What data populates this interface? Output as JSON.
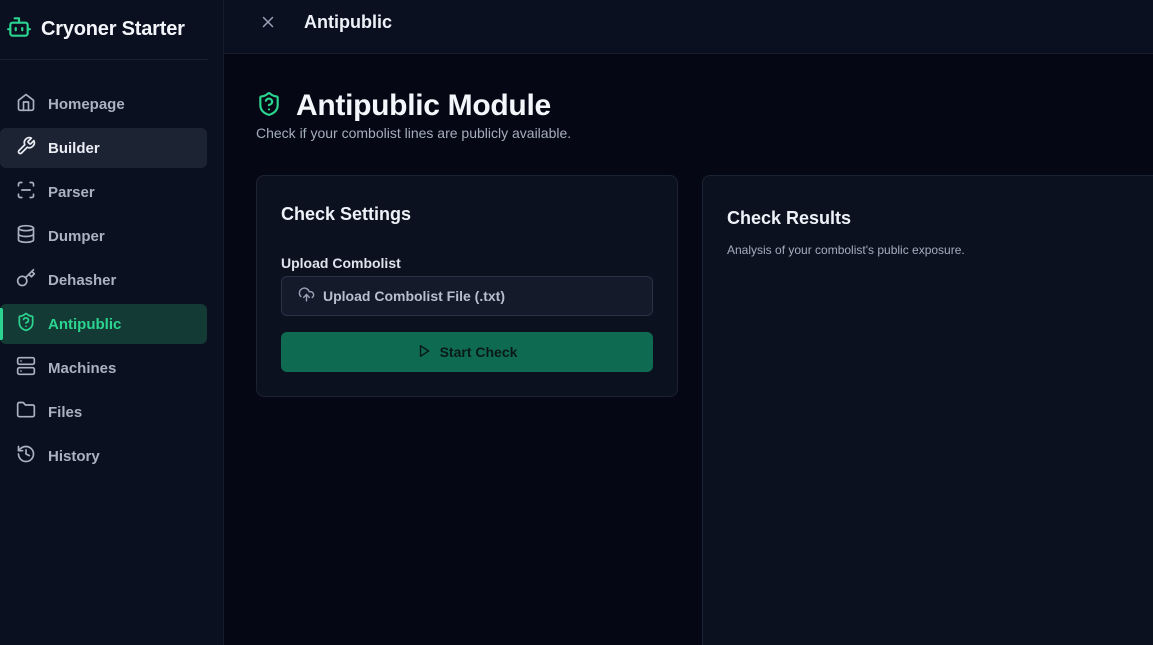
{
  "app": {
    "title": "Cryoner Starter"
  },
  "colors": {
    "accent": "#2bd58f",
    "primary_button": "#0f6a52",
    "background": "#050814",
    "sidebar": "#0b1020"
  },
  "sidebar": {
    "items": [
      {
        "label": "Homepage",
        "icon": "home-icon"
      },
      {
        "label": "Builder",
        "icon": "wrench-icon",
        "state": "hover"
      },
      {
        "label": "Parser",
        "icon": "scan-icon"
      },
      {
        "label": "Dumper",
        "icon": "database-icon"
      },
      {
        "label": "Dehasher",
        "icon": "key-icon"
      },
      {
        "label": "Antipublic",
        "icon": "shield-question-icon",
        "state": "active"
      },
      {
        "label": "Machines",
        "icon": "server-icon"
      },
      {
        "label": "Files",
        "icon": "folder-icon"
      },
      {
        "label": "History",
        "icon": "history-icon"
      }
    ]
  },
  "topbar": {
    "title": "Antipublic"
  },
  "page": {
    "title": "Antipublic Module",
    "subtitle": "Check if your combolist lines are publicly available."
  },
  "settings": {
    "title": "Check Settings",
    "upload_label": "Upload Combolist",
    "upload_button": "Upload Combolist File (.txt)",
    "start_button": "Start Check"
  },
  "results": {
    "title": "Check Results",
    "description": "Analysis of your combolist's public exposure."
  }
}
